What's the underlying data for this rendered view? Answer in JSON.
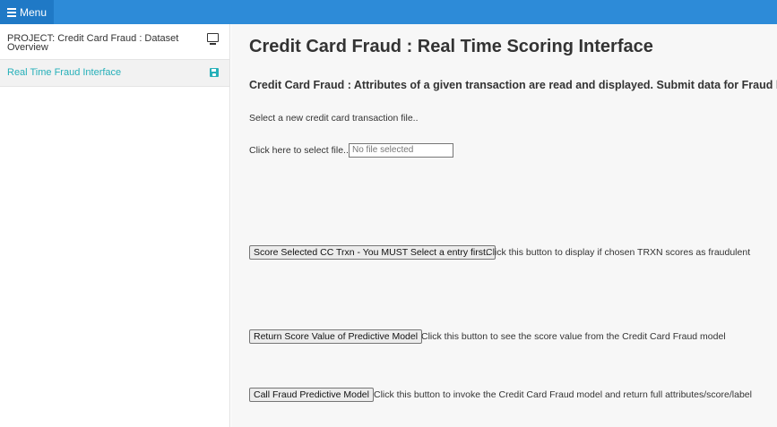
{
  "topbar": {
    "menu_label": "Menu"
  },
  "sidebar": {
    "items": [
      {
        "label": "PROJECT: Credit Card Fraud : Dataset Overview",
        "icon": "monitor-icon"
      },
      {
        "label": "Real Time Fraud Interface",
        "icon": "save-icon",
        "active": true
      }
    ]
  },
  "main": {
    "title": "Credit Card Fraud : Real Time Scoring Interface",
    "subtitle": "Credit Card Fraud : Attributes of a given transaction are read and displayed. Submit data for Fraud l",
    "select_prompt": "Select a new credit card transaction file..",
    "file_label": "Click here to select file...",
    "file_value": "No file selected",
    "actions": [
      {
        "button": "Score Selected CC Trxn - You MUST Select a entry first..",
        "description": "Click this button to display if chosen TRXN scores as fraudulent"
      },
      {
        "button": "Return Score Value of Predictive Model",
        "description": "Click this button to see the score value from the Credit Card Fraud model"
      },
      {
        "button": "Call Fraud Predictive Model",
        "description": "Click this button to invoke the Credit Card Fraud model and return full attributes/score/label"
      }
    ]
  },
  "colors": {
    "topbar": "#2d8bd8",
    "menu_button": "#1f79c6",
    "active_accent": "#26b0b9"
  }
}
